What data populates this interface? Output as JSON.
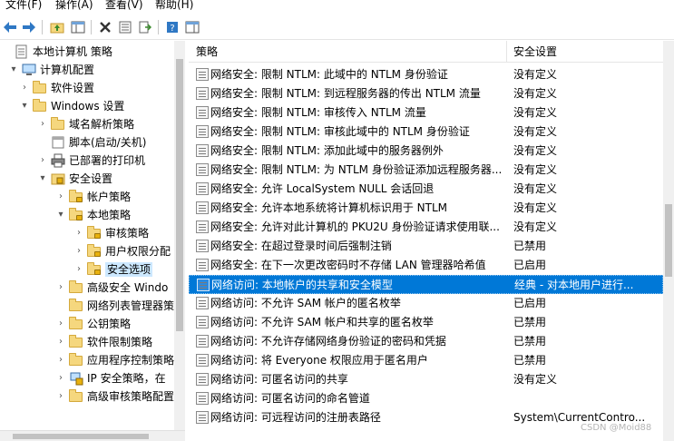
{
  "menubar": {
    "items": [
      "文件(F)",
      "操作(A)",
      "查看(V)",
      "帮助(H)"
    ]
  },
  "toolbar": {
    "buttons": [
      {
        "icon": "back-arrow-icon"
      },
      {
        "icon": "forward-arrow-icon"
      },
      {
        "icon": "up-folder-icon"
      },
      {
        "icon": "show-hide-tree-icon"
      },
      {
        "icon": "delete-icon"
      },
      {
        "icon": "properties-icon"
      },
      {
        "icon": "export-list-icon"
      },
      {
        "icon": "help-icon"
      },
      {
        "icon": "show-hide-action-pane-icon"
      }
    ]
  },
  "tree": {
    "items": [
      {
        "label": "本地计算机 策略",
        "icon": "policy-icon"
      },
      {
        "label": "计算机配置",
        "icon": "computer-icon",
        "chevron": "▾"
      },
      {
        "label": "软件设置",
        "icon": "folder-icon",
        "chevron": "›"
      },
      {
        "label": "Windows 设置",
        "icon": "folder-icon",
        "chevron": "▾"
      },
      {
        "label": "域名解析策略",
        "icon": "folder-icon",
        "chevron": "›"
      },
      {
        "label": "脚本(启动/关机)",
        "icon": "script-icon"
      },
      {
        "label": "已部署的打印机",
        "icon": "printer-icon",
        "chevron": "›"
      },
      {
        "label": "安全设置",
        "icon": "security-icon",
        "chevron": "▾"
      },
      {
        "label": "帐户策略",
        "icon": "folder-lock-icon",
        "chevron": "›"
      },
      {
        "label": "本地策略",
        "icon": "folder-lock-icon",
        "chevron": "▾"
      },
      {
        "label": "审核策略",
        "icon": "folder-lock-icon",
        "chevron": "›"
      },
      {
        "label": "用户权限分配",
        "icon": "folder-lock-icon",
        "chevron": "›"
      },
      {
        "label": "安全选项",
        "icon": "folder-lock-icon",
        "chevron": "›",
        "selected": true
      },
      {
        "label": "高级安全 Windo",
        "icon": "folder-icon",
        "chevron": "›"
      },
      {
        "label": "网络列表管理器策略",
        "icon": "folder-icon"
      },
      {
        "label": "公钥策略",
        "icon": "folder-icon",
        "chevron": "›"
      },
      {
        "label": "软件限制策略",
        "icon": "folder-icon",
        "chevron": "›"
      },
      {
        "label": "应用程序控制策略",
        "icon": "folder-icon",
        "chevron": "›"
      },
      {
        "label": "IP 安全策略，在",
        "icon": "ip-security-icon",
        "chevron": "›"
      },
      {
        "label": "高级审核策略配置",
        "icon": "folder-icon",
        "chevron": "›"
      }
    ]
  },
  "list": {
    "header": {
      "policy": "策略",
      "setting": "安全设置"
    },
    "rows": [
      {
        "name": "网络安全: 限制 NTLM: 此域中的 NTLM 身份验证",
        "value": "没有定义"
      },
      {
        "name": "网络安全: 限制 NTLM: 到远程服务器的传出 NTLM 流量",
        "value": "没有定义"
      },
      {
        "name": "网络安全: 限制 NTLM: 审核传入 NTLM 流量",
        "value": "没有定义"
      },
      {
        "name": "网络安全: 限制 NTLM: 审核此域中的 NTLM 身份验证",
        "value": "没有定义"
      },
      {
        "name": "网络安全: 限制 NTLM: 添加此域中的服务器例外",
        "value": "没有定义"
      },
      {
        "name": "网络安全: 限制 NTLM: 为 NTLM 身份验证添加远程服务器...",
        "value": "没有定义"
      },
      {
        "name": "网络安全: 允许 LocalSystem NULL 会话回退",
        "value": "没有定义"
      },
      {
        "name": "网络安全: 允许本地系统将计算机标识用于 NTLM",
        "value": "没有定义"
      },
      {
        "name": "网络安全: 允许对此计算机的 PKU2U 身份验证请求使用联...",
        "value": "没有定义"
      },
      {
        "name": "网络安全: 在超过登录时间后强制注销",
        "value": "已禁用"
      },
      {
        "name": "网络安全: 在下一次更改密码时不存储 LAN 管理器哈希值",
        "value": "已启用"
      },
      {
        "name": "网络访问: 本地帐户的共享和安全模型",
        "value": "经典 - 对本地用户进行...",
        "selected": true
      },
      {
        "name": "网络访问: 不允许 SAM 帐户的匿名枚举",
        "value": "已启用"
      },
      {
        "name": "网络访问: 不允许 SAM 帐户和共享的匿名枚举",
        "value": "已禁用"
      },
      {
        "name": "网络访问: 不允许存储网络身份验证的密码和凭据",
        "value": "已禁用"
      },
      {
        "name": "网络访问: 将 Everyone 权限应用于匿名用户",
        "value": "已禁用"
      },
      {
        "name": "网络访问: 可匿名访问的共享",
        "value": "没有定义"
      },
      {
        "name": "网络访问: 可匿名访问的命名管道",
        "value": ""
      },
      {
        "name": "网络访问: 可远程访问的注册表路径",
        "value": "System\\CurrentContro..."
      }
    ]
  },
  "watermark": "CSDN @Moid88"
}
